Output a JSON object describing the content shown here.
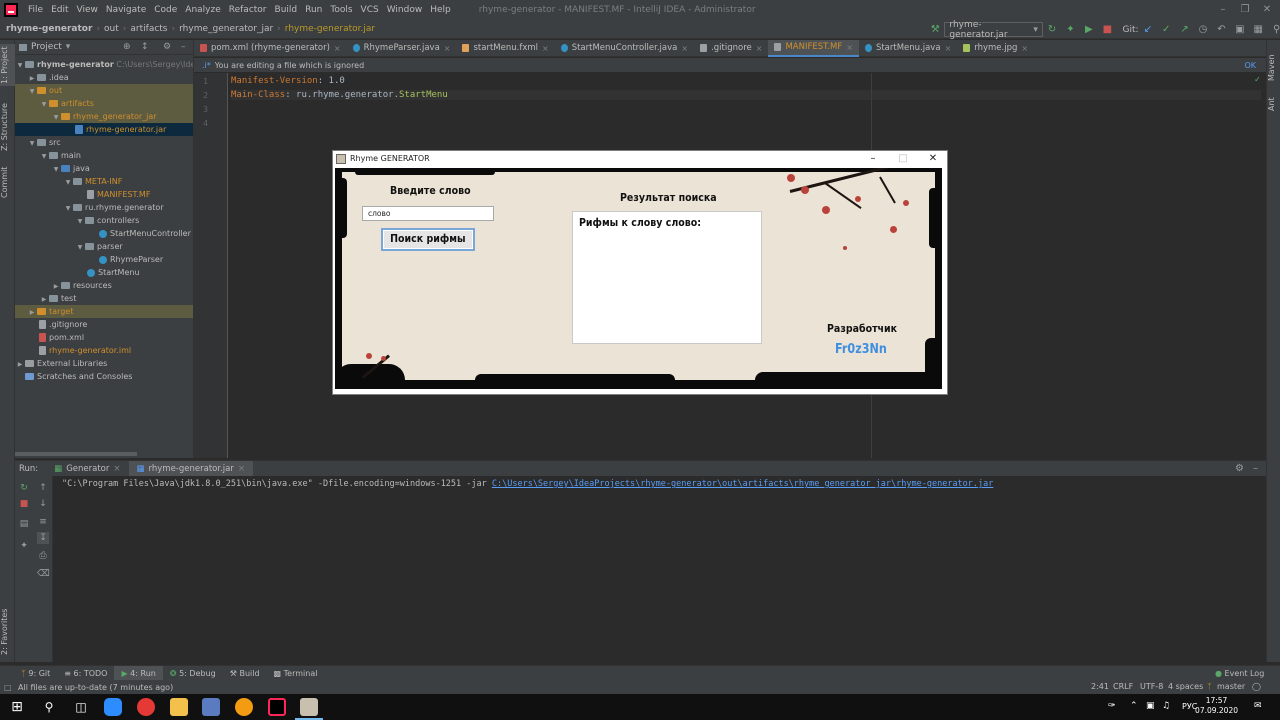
{
  "menubar": {
    "items": [
      "File",
      "Edit",
      "View",
      "Navigate",
      "Code",
      "Analyze",
      "Refactor",
      "Build",
      "Run",
      "Tools",
      "VCS",
      "Window",
      "Help"
    ],
    "window_title": "rhyme-generator - MANIFEST.MF - IntelliJ IDEA - Administrator"
  },
  "navbar": {
    "crumbs": [
      "rhyme-generator",
      "out",
      "artifacts",
      "rhyme_generator_jar",
      "rhyme-generator.jar"
    ],
    "run_config": "rhyme-generator.jar",
    "git_label": "Git:"
  },
  "project": {
    "header": "Project",
    "root_label": "rhyme-generator",
    "root_path": "C:\\Users\\Sergey\\IdeaPro",
    "rows": [
      {
        "label": ".idea"
      },
      {
        "label": "out"
      },
      {
        "label": "artifacts"
      },
      {
        "label": "rhyme_generator_jar"
      },
      {
        "label": "rhyme-generator.jar"
      },
      {
        "label": "src"
      },
      {
        "label": "main"
      },
      {
        "label": "java"
      },
      {
        "label": "META-INF"
      },
      {
        "label": "MANIFEST.MF"
      },
      {
        "label": "ru.rhyme.generator"
      },
      {
        "label": "controllers"
      },
      {
        "label": "StartMenuController"
      },
      {
        "label": "parser"
      },
      {
        "label": "RhymeParser"
      },
      {
        "label": "StartMenu"
      },
      {
        "label": "resources"
      },
      {
        "label": "test"
      },
      {
        "label": "target"
      },
      {
        "label": ".gitignore"
      },
      {
        "label": "pom.xml"
      },
      {
        "label": "rhyme-generator.iml"
      },
      {
        "label": "External Libraries"
      },
      {
        "label": "Scratches and Consoles"
      }
    ]
  },
  "left_strip": {
    "project": "1: Project",
    "structure": "Z: Structure",
    "commit": "Commit",
    "favorites": "2: Favorites"
  },
  "right_strip": {
    "maven": "Maven",
    "ant": "Ant"
  },
  "editor": {
    "tabs": [
      "pom.xml (rhyme-generator)",
      "RhymeParser.java",
      "startMenu.fxml",
      "StartMenuController.java",
      ".gitignore",
      "MANIFEST.MF",
      "StartMenu.java",
      "rhyme.jpg"
    ],
    "banner_text": "You are editing a file which is ignored",
    "banner_ok": "OK",
    "lines": [
      {
        "no": "1",
        "key": "Manifest-Version",
        "sep": ": ",
        "val": "1.0",
        "cls": ""
      },
      {
        "no": "2",
        "key": "Main-Class",
        "sep": ": ",
        "val": "ru.rhyme.generator.",
        "cls": "StartMenu"
      },
      {
        "no": "3"
      },
      {
        "no": "4"
      }
    ]
  },
  "app": {
    "title": "Rhyme GENERATOR",
    "enter_word_label": "Введите слово",
    "input_value": "слово",
    "search_button": "Поиск рифмы",
    "result_label": "Результат поиска",
    "result_text": "Рифмы к слову слово:",
    "developer_label": "Разработчик",
    "developer_name": "Fr0z3Nn"
  },
  "run": {
    "label": "Run:",
    "tabs": [
      "Generator",
      "rhyme-generator.jar"
    ],
    "command": "\"C:\\Program Files\\Java\\jdk1.8.0_251\\bin\\java.exe\" -Dfile.encoding=windows-1251 -jar ",
    "command_link": "C:\\Users\\Sergey\\IdeaProjects\\rhyme-generator\\out\\artifacts\\rhyme_generator_jar\\rhyme-generator.jar"
  },
  "bottom_tabs": [
    "9: Git",
    "6: TODO",
    "4: Run",
    "5: Debug",
    "Build",
    "Terminal"
  ],
  "event_log": "Event Log",
  "status": {
    "message": "All files are up-to-date (7 minutes ago)",
    "position": "2:41",
    "line_sep": "CRLF",
    "encoding": "UTF-8",
    "indent": "4 spaces",
    "branch": "master"
  },
  "taskbar": {
    "lang": "РУС",
    "time": "17:57",
    "date": "07.09.2020"
  }
}
